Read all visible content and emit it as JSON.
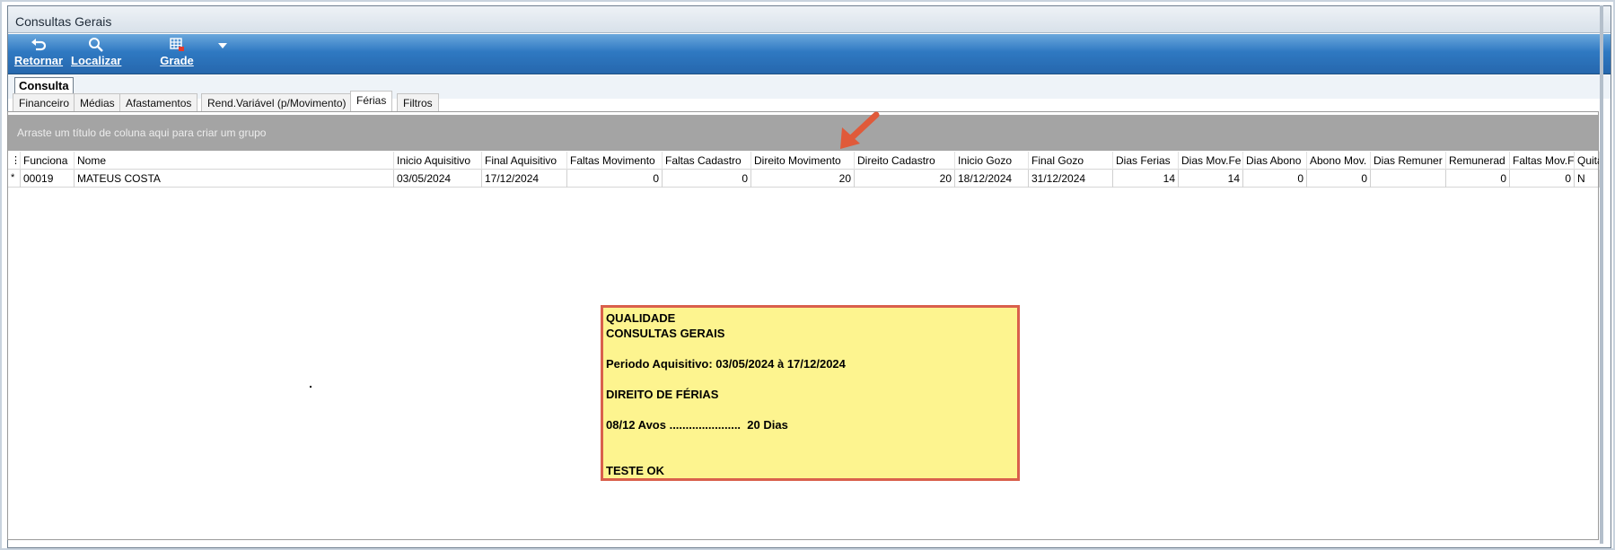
{
  "window": {
    "title": "Consultas Gerais"
  },
  "toolbar": {
    "retornar": "Retornar",
    "localizar": "Localizar",
    "grade": "Grade"
  },
  "subtab": {
    "consulta": "Consulta"
  },
  "tabs": [
    "Financeiro",
    "Médias",
    "Afastamentos",
    "Rend.Variável (p/Movimento)",
    "Férias",
    "Filtros"
  ],
  "active_tab": "Férias",
  "groupbar": {
    "hint": "Arraste um título de coluna aqui para criar um grupo"
  },
  "grid": {
    "columns": [
      "Funciona",
      "Nome",
      "Inicio Aquisitivo",
      "Final Aquisitivo",
      "Faltas Movimento",
      "Faltas Cadastro",
      "Direito Movimento",
      "Direito Cadastro",
      "Inicio Gozo",
      "Final Gozo",
      "Dias Ferias",
      "Dias Mov.Fe",
      "Dias Abono",
      "Abono Mov.",
      "Dias Remuner",
      "Remunerad",
      "Faltas Mov.F",
      "Quitac"
    ],
    "row": {
      "indicator": "*",
      "values": [
        "00019",
        "MATEUS COSTA",
        "03/05/2024",
        "17/12/2024",
        "0",
        "0",
        "20",
        "20",
        "18/12/2024",
        "31/12/2024",
        "14",
        "14",
        "0",
        "0",
        "",
        "0",
        "0",
        "N"
      ]
    }
  },
  "note": {
    "line1": "QUALIDADE",
    "line2": "CONSULTAS GERAIS",
    "line3": "Periodo Aquisitivo: 03/05/2024 à 17/12/2024",
    "line4": "DIREITO DE FÉRIAS",
    "line5": "08/12 Avos ......................  20 Dias",
    "line6": "TESTE OK"
  },
  "colors": {
    "toolbar": "#2f79c2",
    "note_bg": "#fdf48f",
    "note_border": "#d9604c",
    "arrow": "#e05a3a",
    "groupbar": "#a4a4a4"
  },
  "icons": {
    "retornar": "undo-arrow-icon",
    "localizar": "magnifier-icon",
    "grade": "grid-icon"
  }
}
